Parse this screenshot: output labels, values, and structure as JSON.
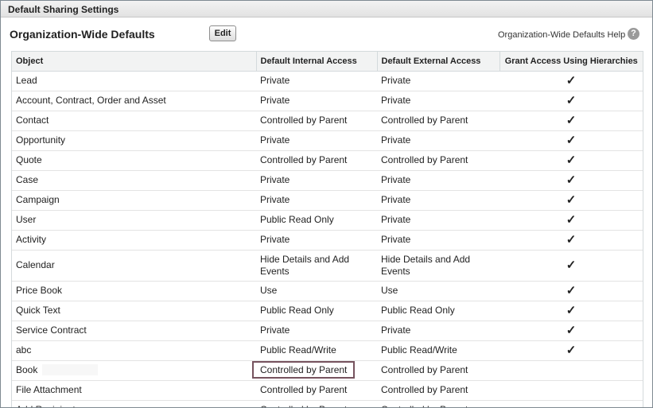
{
  "header": {
    "title": "Default Sharing Settings"
  },
  "section": {
    "title": "Organization-Wide Defaults",
    "edit_label": "Edit",
    "help_label": "Organization-Wide Defaults Help",
    "help_icon": "?"
  },
  "table": {
    "columns": [
      "Object",
      "Default Internal Access",
      "Default External Access",
      "Grant Access Using Hierarchies"
    ],
    "check_glyph": "✓",
    "rows": [
      {
        "object": "Lead",
        "internal": "Private",
        "external": "Private",
        "hierarchy": true
      },
      {
        "object": "Account, Contract, Order and Asset",
        "internal": "Private",
        "external": "Private",
        "hierarchy": true
      },
      {
        "object": "Contact",
        "internal": "Controlled by Parent",
        "external": "Controlled by Parent",
        "hierarchy": true
      },
      {
        "object": "Opportunity",
        "internal": "Private",
        "external": "Private",
        "hierarchy": true
      },
      {
        "object": "Quote",
        "internal": "Controlled by Parent",
        "external": "Controlled by Parent",
        "hierarchy": true
      },
      {
        "object": "Case",
        "internal": "Private",
        "external": "Private",
        "hierarchy": true
      },
      {
        "object": "Campaign",
        "internal": "Private",
        "external": "Private",
        "hierarchy": true
      },
      {
        "object": "User",
        "internal": "Public Read Only",
        "external": "Private",
        "hierarchy": true
      },
      {
        "object": "Activity",
        "internal": "Private",
        "external": "Private",
        "hierarchy": true
      },
      {
        "object": "Calendar",
        "internal": "Hide Details and Add Events",
        "external": "Hide Details and Add Events",
        "hierarchy": true
      },
      {
        "object": "Price Book",
        "internal": "Use",
        "external": "Use",
        "hierarchy": true
      },
      {
        "object": "Quick Text",
        "internal": "Public Read Only",
        "external": "Public Read Only",
        "hierarchy": true
      },
      {
        "object": "Service Contract",
        "internal": "Private",
        "external": "Private",
        "hierarchy": true
      },
      {
        "object": "abc",
        "internal": "Public Read/Write",
        "external": "Public Read/Write",
        "hierarchy": true
      },
      {
        "object": "Book",
        "internal": "Controlled by Parent",
        "external": "Controlled by Parent",
        "hierarchy": false
      },
      {
        "object": "File Attachment",
        "internal": "Controlled by Parent",
        "external": "Controlled by Parent",
        "hierarchy": false
      },
      {
        "object": "Add Recipient",
        "internal": "Controlled by Parent",
        "external": "Controlled by Parent",
        "hierarchy": false
      }
    ]
  }
}
